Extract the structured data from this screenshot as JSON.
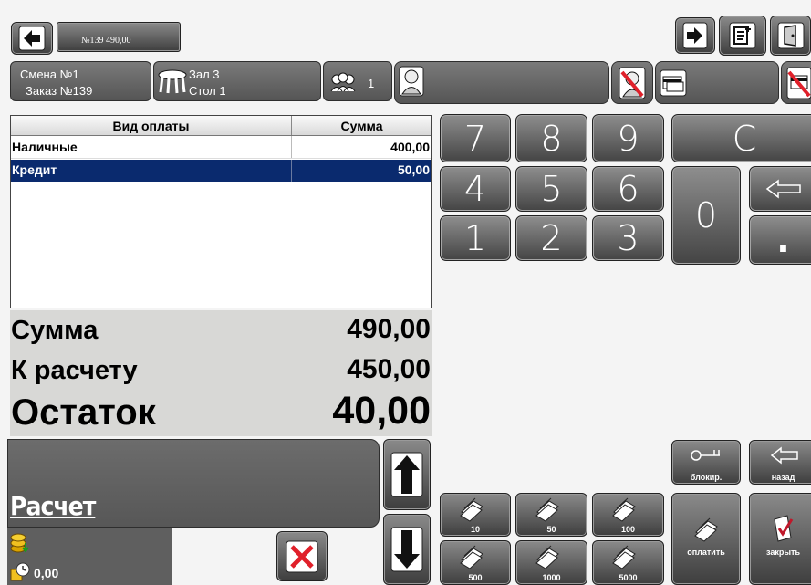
{
  "top_bar": {
    "order_label": "№139   490,00"
  },
  "info": {
    "shift": "Смена №1",
    "order": "Заказ №139",
    "hall": "Зал 3",
    "table": "Стол 1",
    "guests": "1"
  },
  "payments": {
    "headers": [
      "Вид оплаты",
      "Сумма"
    ],
    "rows": [
      {
        "type": "Наличные",
        "amount": "400,00"
      },
      {
        "type": "Кредит",
        "amount": "50,00"
      }
    ]
  },
  "totals": {
    "sum_label": "Сумма",
    "sum_value": "490,00",
    "due_label": "К расчету",
    "due_value": "450,00",
    "rest_label": "Остаток",
    "rest_value": "40,00"
  },
  "keypad": {
    "k7": "7",
    "k8": "8",
    "k9": "9",
    "clear": "C",
    "k4": "4",
    "k5": "5",
    "k6": "6",
    "k0": "0",
    "k1": "1",
    "k2": "2",
    "k3": "3",
    "dot": "."
  },
  "bottom": {
    "calc_label": "Расчет",
    "balance": "0,00",
    "cash": [
      "10",
      "50",
      "100",
      "500",
      "1000",
      "5000"
    ],
    "lock": "блокир.",
    "back": "назад",
    "pay": "оплатить",
    "close": "закрыть"
  },
  "colors": {
    "selected_row": "#0a2a6e",
    "accent_red": "#e0202a"
  }
}
